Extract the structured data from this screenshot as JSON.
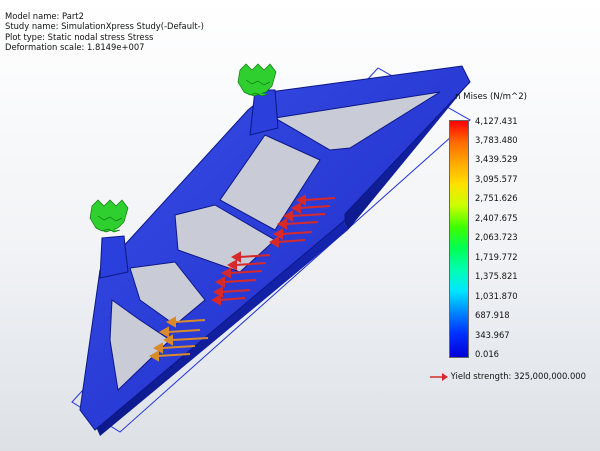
{
  "info": {
    "model_name": "Model name: Part2",
    "study_name": "Study name: SimulationXpress Study(-Default-)",
    "plot_type": "Plot type: Static nodal stress Stress",
    "deformation_scale": "Deformation scale: 1.8149e+007"
  },
  "legend": {
    "title": "n Mises (N/m^2)",
    "ticks": [
      "4,127.431",
      "3,783.480",
      "3,439.529",
      "3,095.577",
      "2,751.626",
      "2,407.675",
      "2,063.723",
      "1,719.772",
      "1,375.821",
      "1,031.870",
      "687.918",
      "343.967",
      "0.016"
    ],
    "yield_strength": "Yield strength: 325,000,000.000"
  },
  "colors": {
    "model": "#1f2ed0",
    "fixture": "#2fcf2f",
    "load_red": "#d62a2a",
    "load_orange": "#d98a2a"
  }
}
